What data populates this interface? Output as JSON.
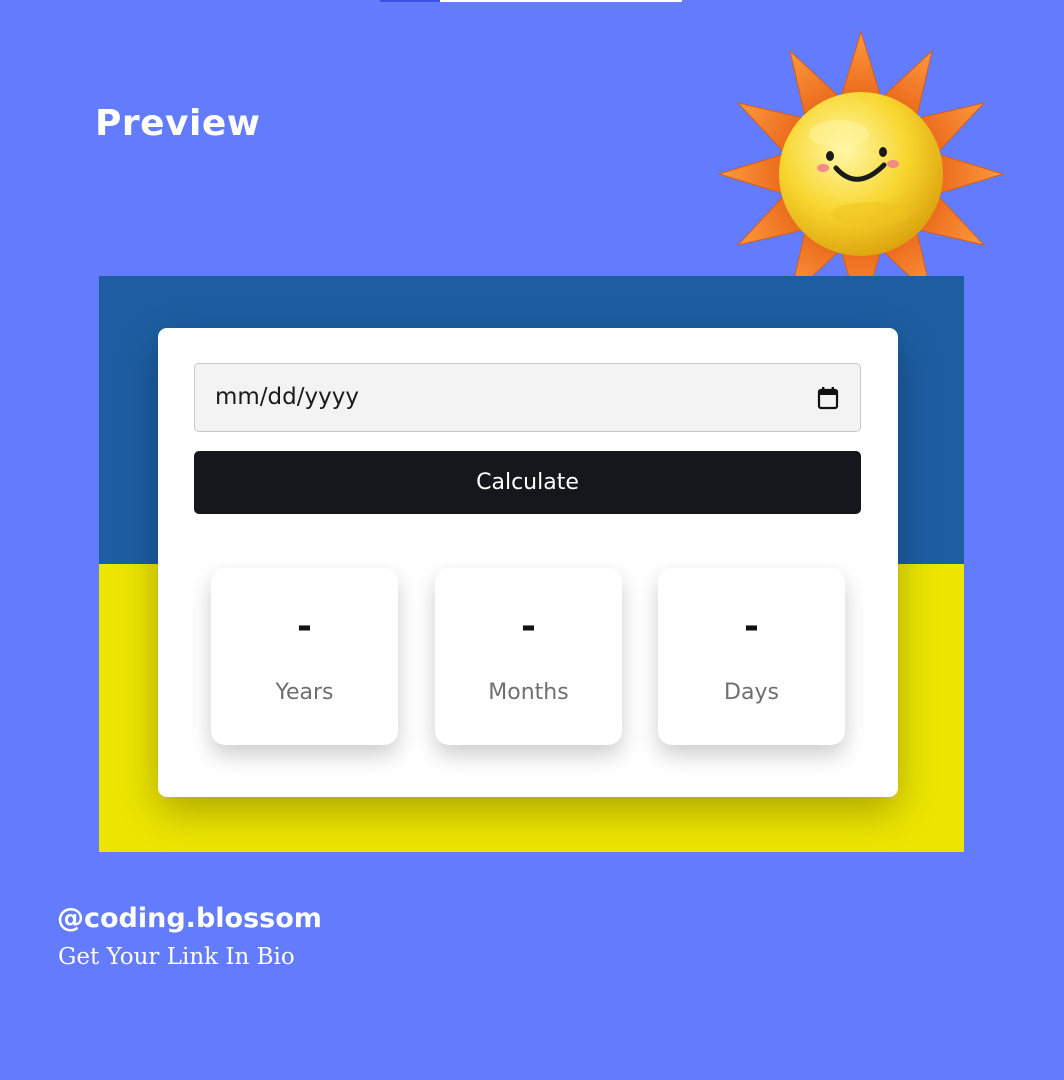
{
  "header": {
    "title": "Preview"
  },
  "calculator": {
    "date_input": {
      "placeholder": "mm/dd/yyyy",
      "icon": "calendar-icon"
    },
    "calculate_label": "Calculate",
    "results": [
      {
        "value": "-",
        "label": "Years"
      },
      {
        "value": "-",
        "label": "Months"
      },
      {
        "value": "-",
        "label": "Days"
      }
    ]
  },
  "footer": {
    "handle": "@coding.blossom",
    "tagline": "Get Your Link In Bio"
  },
  "colors": {
    "page_background": "#637cfd",
    "flag_blue": "#1d5ea2",
    "flag_yellow": "#ece500",
    "button_background": "#16171c",
    "card_background": "#ffffff"
  },
  "decoration": {
    "image": "smiling-sun-icon"
  }
}
